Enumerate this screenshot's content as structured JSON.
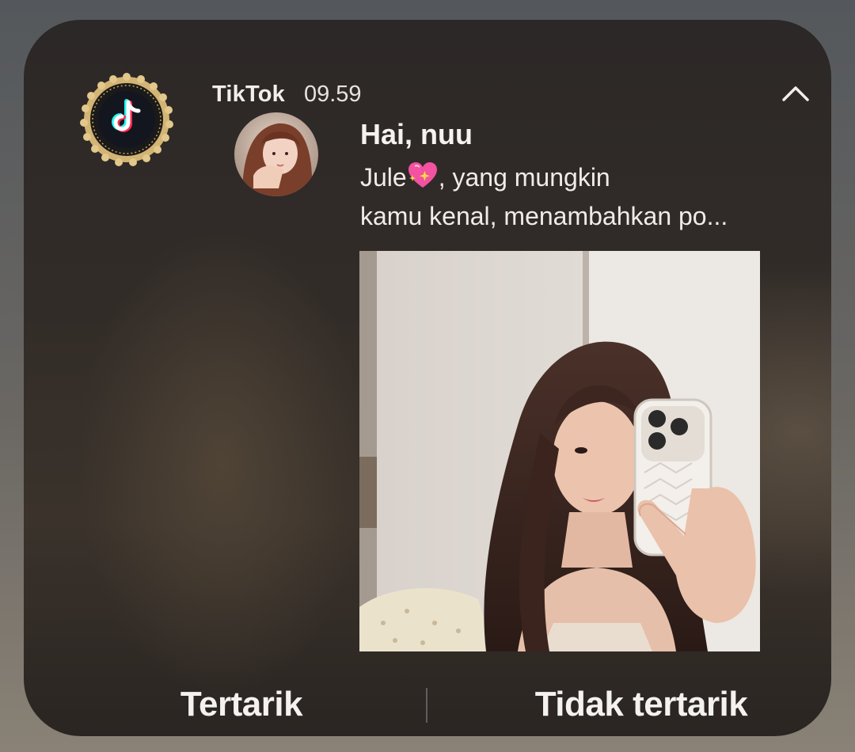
{
  "notification": {
    "app_name": "TikTok",
    "time": "09.59",
    "title": "Hai, nuu",
    "body_line1_name": "Jule",
    "body_line1_rest": ", yang mungkin",
    "body_line2": "kamu kenal, menambahkan po...",
    "collapse_icon": "chevron-up-icon",
    "app_icon": "tiktok-logo-icon",
    "heart_emoji_icon": "sparkling-heart-emoji-icon"
  },
  "actions": {
    "interested_label": "Tertarik",
    "not_interested_label": "Tidak tertarik"
  },
  "colors": {
    "text_primary": "#f4f2ee",
    "badge_gold": "#c9a55a",
    "tiktok_cyan": "#25f4ee",
    "tiktok_red": "#fe2c55"
  }
}
